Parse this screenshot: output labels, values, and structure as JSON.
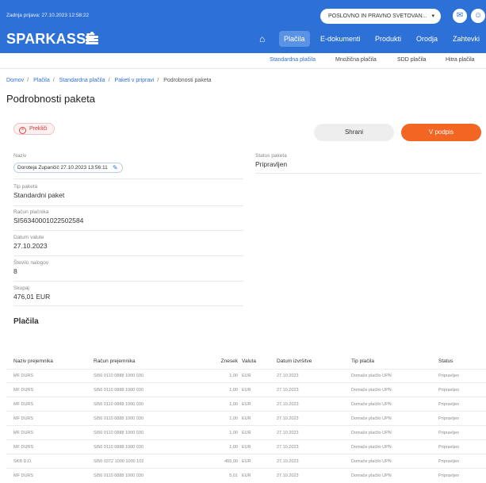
{
  "header": {
    "last_login": "Zadnja prijava: 27.10.2023 12:58:22",
    "profile_selector": "POSLOVNO IN PRAVNO SVETOVAN...",
    "messages_icon": "mail-icon",
    "user_icon": "user-icon",
    "brand": "SPARKASSE",
    "home_icon": "home-icon",
    "nav": [
      "Plačila",
      "E-dokumenti",
      "Produkti",
      "Orodja",
      "Zahtevki"
    ],
    "active_nav": "Plačila"
  },
  "subnav": {
    "items": [
      "Standardna plačila",
      "Množična plačila",
      "SDD plačila",
      "Hitra plačila"
    ],
    "active": "Standardna plačila"
  },
  "breadcrumb": [
    "Domov",
    "Plačila",
    "Standardna plačila",
    "Paketi v pripravi",
    "Podrobnosti paketa"
  ],
  "page_title": "Podrobnosti paketa",
  "actions": {
    "cancel": "Prekliči",
    "save": "Shrani",
    "sign": "V podpis"
  },
  "details": {
    "name_label": "Naziv",
    "name_value": "Doroteja Zupančič 27.10.2023 13:56:11",
    "type_label": "Tip paketa",
    "type_value": "Standardni paket",
    "account_label": "Račun plačnika",
    "account_value": "SI56340001022502584",
    "date_label": "Datum valute",
    "date_value": "27.10.2023",
    "count_label": "Število nalogov",
    "count_value": "8",
    "total_label": "Skupaj",
    "total_value": "476,01 EUR",
    "status_label": "Status paketa",
    "status_value": "Pripravljen"
  },
  "payments": {
    "title": "Plačila",
    "columns": [
      "Naziv prejemnika",
      "Račun prejemnika",
      "Znesek",
      "Valuta",
      "Datum izvršitve",
      "Tip plačila",
      "Status"
    ],
    "rows": [
      [
        "MF DURS",
        "SI56 0110 0888 1000 030",
        "1,00",
        "EUR",
        "27.10.2023",
        "Domače plačilo UPN",
        "Pripravljen"
      ],
      [
        "MF DURS",
        "SI56 0110 0888 1000 030",
        "1,00",
        "EUR",
        "27.10.2023",
        "Domače plačilo UPN",
        "Pripravljen"
      ],
      [
        "MF DURS",
        "SI56 0110 0888 1000 030",
        "1,00",
        "EUR",
        "27.10.2023",
        "Domače plačilo UPN",
        "Pripravljen"
      ],
      [
        "MF DURS",
        "SI56 0110 0888 1000 030",
        "1,00",
        "EUR",
        "27.10.2023",
        "Domače plačilo UPN",
        "Pripravljen"
      ],
      [
        "MF DURS",
        "SI56 0110 0888 1000 030",
        "1,00",
        "EUR",
        "27.10.2023",
        "Domače plačilo UPN",
        "Pripravljen"
      ],
      [
        "MF DURS",
        "SI56 0110 0888 1000 030",
        "1,00",
        "EUR",
        "27.10.2023",
        "Domače plačilo UPN",
        "Pripravljen"
      ],
      [
        "SKB D.D.",
        "SI56 0372 1000 1000 102",
        "465,00",
        "EUR",
        "27.10.2023",
        "Domače plačilo UPN",
        "Pripravljen"
      ],
      [
        "MF DURS",
        "SI56 0110 0888 1000 030",
        "5,01",
        "EUR",
        "27.10.2023",
        "Domače plačilo UPN",
        "Pripravljen"
      ]
    ]
  },
  "colors": {
    "brand_blue": "#2e71d6",
    "accent_orange": "#f26522",
    "cancel_red": "#c83a3a"
  }
}
